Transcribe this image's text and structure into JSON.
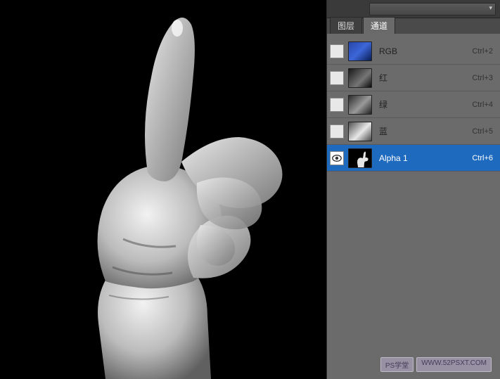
{
  "tabs": {
    "layers": "图层",
    "channels": "通道"
  },
  "channels": [
    {
      "name": "RGB",
      "shortcut": "Ctrl+2",
      "visible": false,
      "selected": false,
      "thumb": "rgb"
    },
    {
      "name": "红",
      "shortcut": "Ctrl+3",
      "visible": false,
      "selected": false,
      "thumb": "red"
    },
    {
      "name": "绿",
      "shortcut": "Ctrl+4",
      "visible": false,
      "selected": false,
      "thumb": "green"
    },
    {
      "name": "蓝",
      "shortcut": "Ctrl+5",
      "visible": false,
      "selected": false,
      "thumb": "blue"
    },
    {
      "name": "Alpha 1",
      "shortcut": "Ctrl+6",
      "visible": true,
      "selected": true,
      "thumb": "alpha"
    }
  ],
  "watermark": {
    "left": "PS学堂",
    "right": "WWW.52PSXT.COM"
  }
}
